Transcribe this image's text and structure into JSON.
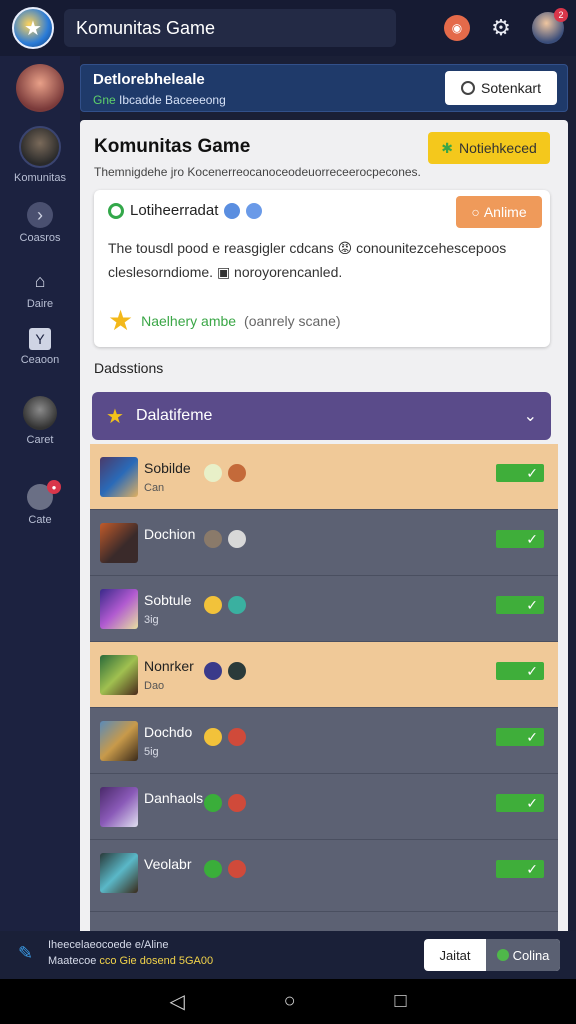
{
  "header": {
    "title": "Komunitas Game",
    "notif_badge": "2"
  },
  "sidebar": {
    "items": [
      {
        "label": ""
      },
      {
        "label": "Komunitas"
      },
      {
        "label": "Coasros"
      },
      {
        "label": "Daire"
      },
      {
        "label": "Ceaoon"
      },
      {
        "label": "Caret"
      },
      {
        "label": "Cate"
      }
    ]
  },
  "banner": {
    "title": "Detlorebheleale",
    "line_green": "Gne",
    "line_rest": " Ibcadde Baceeeong",
    "button_label": "Sotenkart"
  },
  "panel": {
    "title": "Komunitas Game",
    "subtitle": "Themnigdehe jro Kocenerreocanoceodeuorreceerocpecones.",
    "yellow_button": "Notiehkeced",
    "card": {
      "heading": "Lotiheerradat",
      "status_button": "Anlime",
      "body": "The tousdl pood e reasgigler cdcans 😡 conounitezcehescepoos cleslesorndiome. ▣ noroyorencanled.",
      "star_green": "Naelhery ambe",
      "star_grey": "(oanrely scane)"
    },
    "section_label": "Dadsstions",
    "group_label": "Dalatifeme"
  },
  "list": [
    {
      "name": "Sobilde",
      "sub": "Can",
      "highlighted": true
    },
    {
      "name": "Dochion",
      "sub": "",
      "highlighted": false
    },
    {
      "name": "Sobtule",
      "sub": "3ig",
      "highlighted": false
    },
    {
      "name": "Nonrker",
      "sub": "Dao",
      "highlighted": true
    },
    {
      "name": "Dochdo",
      "sub": "5ig",
      "highlighted": false
    },
    {
      "name": "Danhaols",
      "sub": "",
      "highlighted": false
    },
    {
      "name": "Veolabr",
      "sub": "",
      "highlighted": false
    }
  ],
  "status": {
    "line1": "Iheecelaeocoede e/Aline",
    "line2_a": "Maatecoe ",
    "line2_b": "cco Gie dosend 5GA00",
    "left_button": "Jaitat",
    "right_button": "Colina"
  },
  "colors": {
    "accent_yellow": "#f4c81c",
    "accent_orange": "#ef9a5a",
    "purple": "#5a4b8a",
    "check_green": "#3fae3a"
  }
}
